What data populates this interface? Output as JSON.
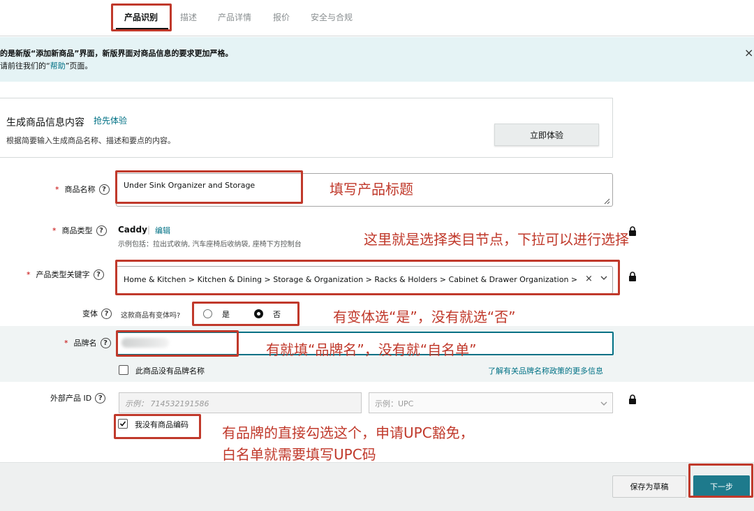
{
  "tabs": [
    {
      "label": "产品识别",
      "active": true
    },
    {
      "label": "描述"
    },
    {
      "label": "产品详情"
    },
    {
      "label": "报价"
    },
    {
      "label": "安全与合规"
    }
  ],
  "banner": {
    "line1": "的是新版“添加新商品”界面，新版界面对商品信息的要求更加严格。",
    "line2_prefix": "请前往我们的“",
    "line2_link": "帮助",
    "line2_suffix": "”页面。",
    "close": "×"
  },
  "gen": {
    "title": "生成商品信息内容",
    "tag": "抢先体验",
    "desc": "根据简要输入生成商品名称、描述和要点的内容。",
    "button": "立即体验"
  },
  "form": {
    "product_name": {
      "label": "商品名称",
      "value": "Under Sink Organizer and Storage"
    },
    "product_type": {
      "label": "商品类型",
      "value": "Caddy",
      "separator": "|",
      "edit": "编辑",
      "examples": "示例包括：拉出式收纳, 汽车座椅后收纳袋, 座椅下方控制台"
    },
    "keyword": {
      "label": "产品类型关键字",
      "value": "Home & Kitchen > Kitchen & Dining > Storage & Organization > Racks & Holders > Cabinet & Drawer Organization > Fla",
      "clear": "×"
    },
    "variation": {
      "label": "变体",
      "question": "这款商品有变体吗?",
      "options": [
        "是",
        "否"
      ],
      "selected": "否"
    },
    "brand": {
      "label": "品牌名",
      "no_brand": "此商品没有品牌名称",
      "policy_link": "了解有关品牌名称政策的更多信息"
    },
    "external_id": {
      "label": "外部产品 ID",
      "placeholder": "示例： 714532191586",
      "type_placeholder": "示例：UPC",
      "no_code": "我没有商品编码",
      "no_code_checked": true
    },
    "required_mark": "*",
    "help_glyph": "?"
  },
  "footer": {
    "save": "保存为草稿",
    "next": "下一步"
  },
  "annotations": {
    "title_note": "填写产品标题",
    "category_note": "这里就是选择类目节点，下拉可以进行选择",
    "variation_note": "有变体选“是”，没有就选“否”",
    "brand_note": "有就填“品牌名”，没有就“自名单”",
    "upc_note_line1": "有品牌的直接勾选这个，申请UPC豁免，",
    "upc_note_line2": "白名单就需要填写UPC码"
  },
  "colors": {
    "annotation": "#c0392b",
    "link": "#007185",
    "primary_button": "#1e7a8c",
    "banner": "#e5f3f5"
  },
  "icons": [
    "help-icon",
    "lock-icon",
    "chevron-down-icon",
    "close-icon",
    "check-icon"
  ]
}
